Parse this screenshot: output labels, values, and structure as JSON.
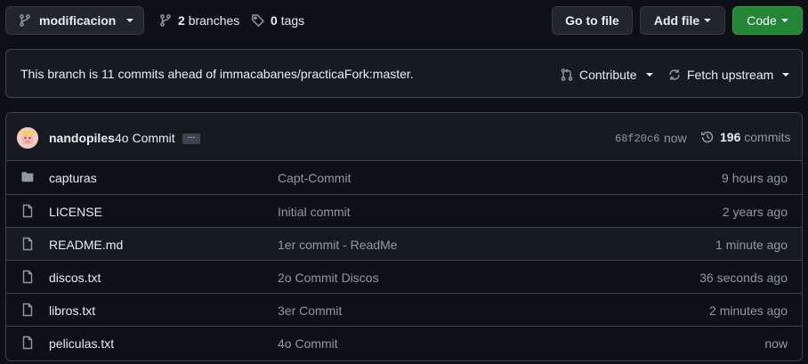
{
  "toolbar": {
    "branch_name": "modificacion",
    "branches_count": "2",
    "branches_label": "branches",
    "tags_count": "0",
    "tags_label": "tags",
    "go_to_file_label": "Go to file",
    "add_file_label": "Add file",
    "code_label": "Code"
  },
  "banner": {
    "text": "This branch is 11 commits ahead of immacabanes/practicaFork:master.",
    "contribute_label": "Contribute",
    "fetch_upstream_label": "Fetch upstream"
  },
  "latest_commit": {
    "author": "nandopiles",
    "message": "4o Commit",
    "ellipsis": "...",
    "sha": "68f20c6",
    "time": "now",
    "commits_count": "196",
    "commits_label": "commits"
  },
  "files": [
    {
      "type": "folder",
      "name": "capturas",
      "message": "Capt-Commit",
      "age": "9 hours ago"
    },
    {
      "type": "file",
      "name": "LICENSE",
      "message": "Initial commit",
      "age": "2 years ago"
    },
    {
      "type": "file",
      "name": "README.md",
      "message": "1er commit - ReadMe",
      "age": "1 minute ago"
    },
    {
      "type": "file",
      "name": "discos.txt",
      "message": "2o Commit Discos",
      "age": "36 seconds ago"
    },
    {
      "type": "file",
      "name": "libros.txt",
      "message": "3er Commit",
      "age": "2 minutes ago"
    },
    {
      "type": "file",
      "name": "peliculas.txt",
      "message": "4o Commit",
      "age": "now"
    }
  ],
  "colors": {
    "background": "#0d1117",
    "surface": "#161b22",
    "border": "#3d444d",
    "button": "#21262d",
    "primary_green": "#238636",
    "text": "#e6edf3",
    "muted_text": "#9198a1"
  },
  "icons": {
    "branch": "git-branch-icon",
    "tag": "tag-icon",
    "contribute": "git-pull-request-icon",
    "fetch": "sync-icon",
    "history": "history-icon",
    "folder": "folder-icon",
    "file": "file-icon"
  }
}
